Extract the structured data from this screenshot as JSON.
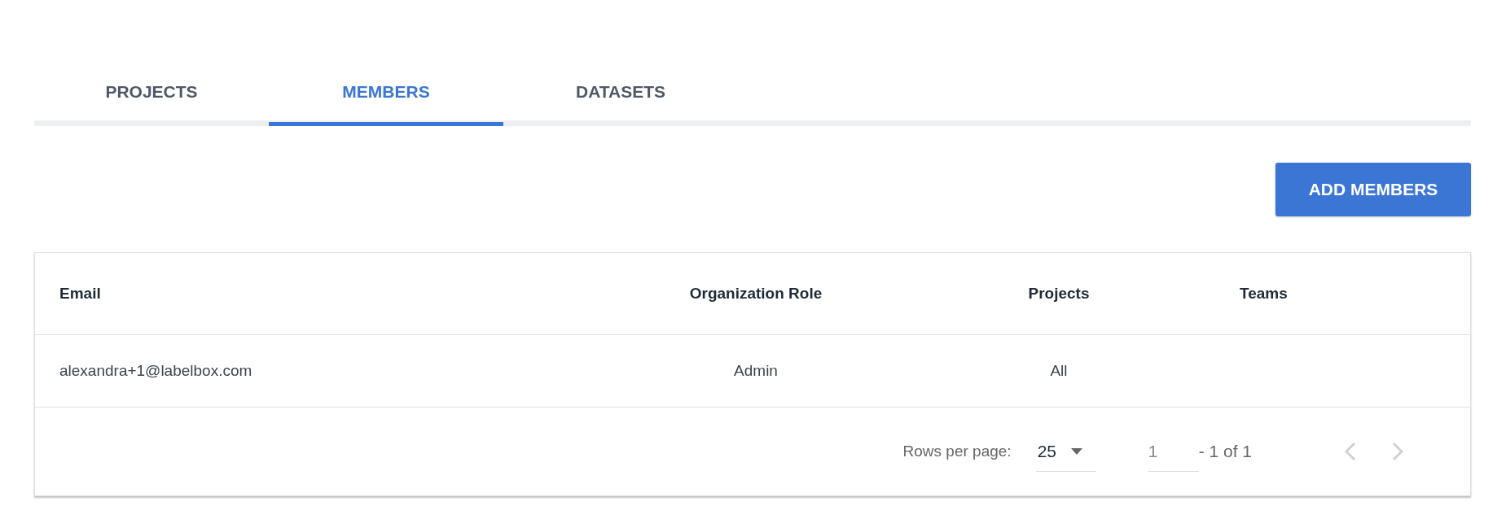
{
  "tabs": [
    {
      "label": "PROJECTS",
      "selected": false
    },
    {
      "label": "MEMBERS",
      "selected": true
    },
    {
      "label": "DATASETS",
      "selected": false
    }
  ],
  "add_button": {
    "label": "ADD MEMBERS"
  },
  "table": {
    "columns": [
      "Email",
      "Organization Role",
      "Projects",
      "Teams"
    ],
    "rows": [
      {
        "email": "alexandra+1@labelbox.com",
        "role": "Admin",
        "projects": "All",
        "teams": ""
      }
    ]
  },
  "pagination": {
    "rows_per_page_label": "Rows per page:",
    "rows_per_page": "25",
    "page": "1",
    "range": "- 1 of 1",
    "prev_disabled": true,
    "next_disabled": true
  }
}
